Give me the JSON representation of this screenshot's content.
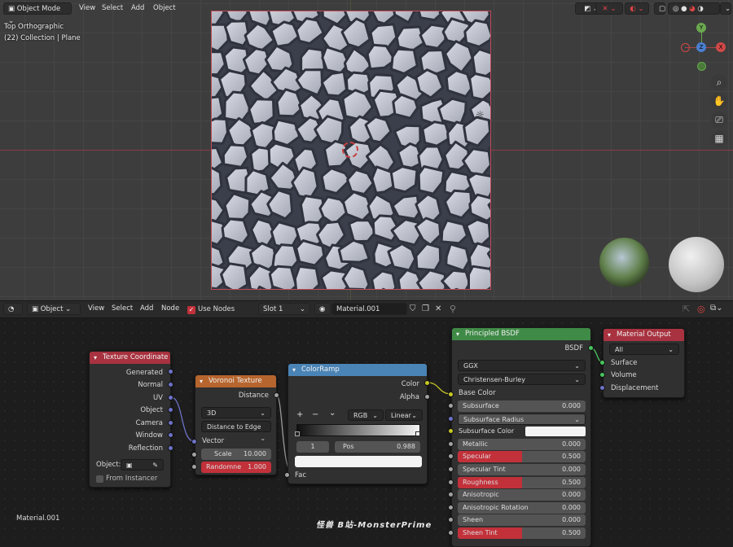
{
  "viewport": {
    "mode": "Object Mode",
    "menus": [
      "View",
      "Select",
      "Add",
      "Object"
    ],
    "view_name": "Top Orthographic",
    "collection": "(22) Collection | Plane",
    "gizmo": {
      "y": "Y",
      "z": "Z",
      "x": "X"
    }
  },
  "node_header": {
    "editor_type": "Object",
    "menus": [
      "View",
      "Select",
      "Add",
      "Node"
    ],
    "use_nodes_label": "Use Nodes",
    "use_nodes_checked": true,
    "slot": "Slot 1",
    "material": "Material.001"
  },
  "nodes": {
    "texture_coordinate": {
      "title": "Texture Coordinate",
      "outputs": [
        "Generated",
        "Normal",
        "UV",
        "Object",
        "Camera",
        "Window",
        "Reflection"
      ],
      "object_label": "Object:",
      "from_instancer": "From Instancer"
    },
    "voronoi": {
      "title": "Voronoi Texture",
      "output": "Distance",
      "dimension": "3D",
      "feature": "Distance to Edge",
      "vector": "Vector",
      "scale_label": "Scale",
      "scale_value": "10.000",
      "randomness_label": "Randomne",
      "randomness_value": "1.000"
    },
    "colorramp": {
      "title": "ColorRamp",
      "outputs": [
        "Color",
        "Alpha"
      ],
      "add": "+",
      "remove": "−",
      "more": "⌄",
      "mode": "RGB",
      "interp": "Linear",
      "index": "1",
      "pos_label": "Pos",
      "pos_value": "0.988",
      "input": "Fac"
    },
    "bsdf": {
      "title": "Principled BSDF",
      "output": "BSDF",
      "distribution": "GGX",
      "sss_method": "Christensen-Burley",
      "base_color": "Base Color",
      "fields": [
        {
          "label": "Subsurface",
          "value": "0.000",
          "highlight": false
        },
        {
          "label": "Subsurface Radius",
          "value": "",
          "highlight": false
        },
        {
          "label": "Subsurface Color",
          "value": "",
          "highlight": false
        },
        {
          "label": "Metallic",
          "value": "0.000",
          "highlight": false
        },
        {
          "label": "Specular",
          "value": "0.500",
          "highlight": true
        },
        {
          "label": "Specular Tint",
          "value": "0.000",
          "highlight": false
        },
        {
          "label": "Roughness",
          "value": "0.500",
          "highlight": true
        },
        {
          "label": "Anisotropic",
          "value": "0.000",
          "highlight": false
        },
        {
          "label": "Anisotropic Rotation",
          "value": "0.000",
          "highlight": false
        },
        {
          "label": "Sheen",
          "value": "0.000",
          "highlight": false
        },
        {
          "label": "Sheen Tint",
          "value": "0.500",
          "highlight": true
        }
      ]
    },
    "output": {
      "title": "Material Output",
      "target": "All",
      "inputs": [
        "Surface",
        "Volume",
        "Displacement"
      ]
    }
  },
  "footer_material": "Material.001",
  "watermark": "怪兽    B站-MonsterPrime",
  "colors": {
    "texture_header": "#a8323f",
    "voronoi_header": "#b7652e",
    "colorramp_header": "#4a83b5",
    "bsdf_header": "#3f8a46",
    "output_header": "#a8323f",
    "slider_red": "#c2313a",
    "plane_outline": "#c24a57"
  }
}
